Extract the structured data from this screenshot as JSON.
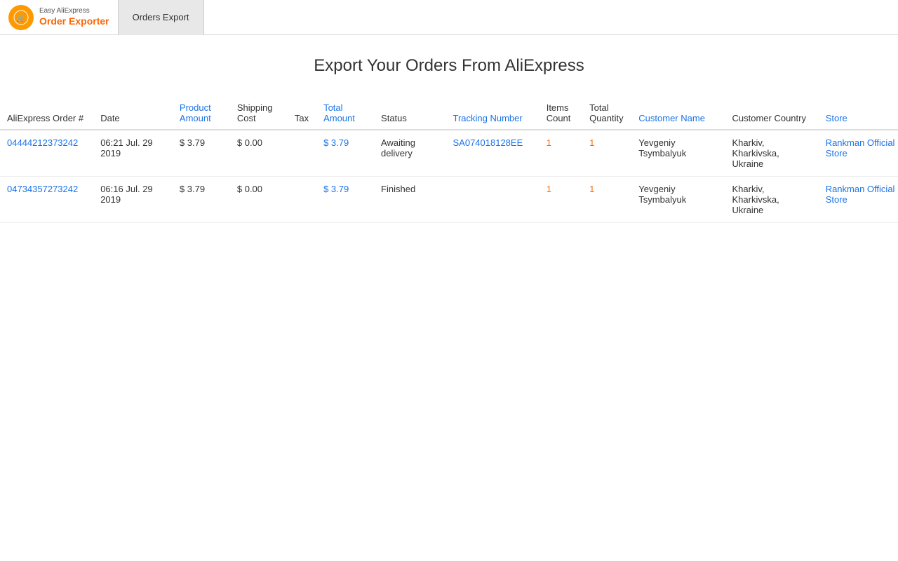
{
  "header": {
    "logo_top": "Easy AliExpress",
    "logo_main": "Order Exporter",
    "nav_tab": "Orders Export"
  },
  "page": {
    "title": "Export Your Orders From AliExpress"
  },
  "table": {
    "columns": [
      {
        "key": "order_num",
        "label": "AliExpress Order #",
        "colored": false
      },
      {
        "key": "date",
        "label": "Date",
        "colored": false
      },
      {
        "key": "product_amount",
        "label": "Product Amount",
        "colored": true
      },
      {
        "key": "shipping_cost",
        "label": "Shipping Cost",
        "colored": false
      },
      {
        "key": "tax",
        "label": "Tax",
        "colored": false
      },
      {
        "key": "total_amount",
        "label": "Total Amount",
        "colored": true
      },
      {
        "key": "status",
        "label": "Status",
        "colored": false
      },
      {
        "key": "tracking_number",
        "label": "Tracking Number",
        "colored": true
      },
      {
        "key": "items_count",
        "label": "Items Count",
        "colored": false
      },
      {
        "key": "total_quantity",
        "label": "Total Quantity",
        "colored": false
      },
      {
        "key": "customer_name",
        "label": "Customer Name",
        "colored": true
      },
      {
        "key": "customer_country",
        "label": "Customer Country",
        "colored": false
      },
      {
        "key": "store",
        "label": "Store",
        "colored": true
      }
    ],
    "rows": [
      {
        "order_num": "04444212373242",
        "date": "06:21 Jul. 29 2019",
        "product_amount": "$ 3.79",
        "shipping_cost": "$ 0.00",
        "tax": "",
        "total_amount": "$ 3.79",
        "status": "Awaiting delivery",
        "tracking_number": "SA074018128EE",
        "items_count": "1",
        "total_quantity": "1",
        "customer_name": "Yevgeniy Tsymbalyuk",
        "customer_country": "Kharkiv, Kharkivska, Ukraine",
        "store": "Rankman Official Store"
      },
      {
        "order_num": "04734357273242",
        "date": "06:16 Jul. 29 2019",
        "product_amount": "$ 3.79",
        "shipping_cost": "$ 0.00",
        "tax": "",
        "total_amount": "$ 3.79",
        "status": "Finished",
        "tracking_number": "",
        "items_count": "1",
        "total_quantity": "1",
        "customer_name": "Yevgeniy Tsymbalyuk",
        "customer_country": "Kharkiv, Kharkivska, Ukraine",
        "store": "Rankman Official Store"
      }
    ]
  }
}
